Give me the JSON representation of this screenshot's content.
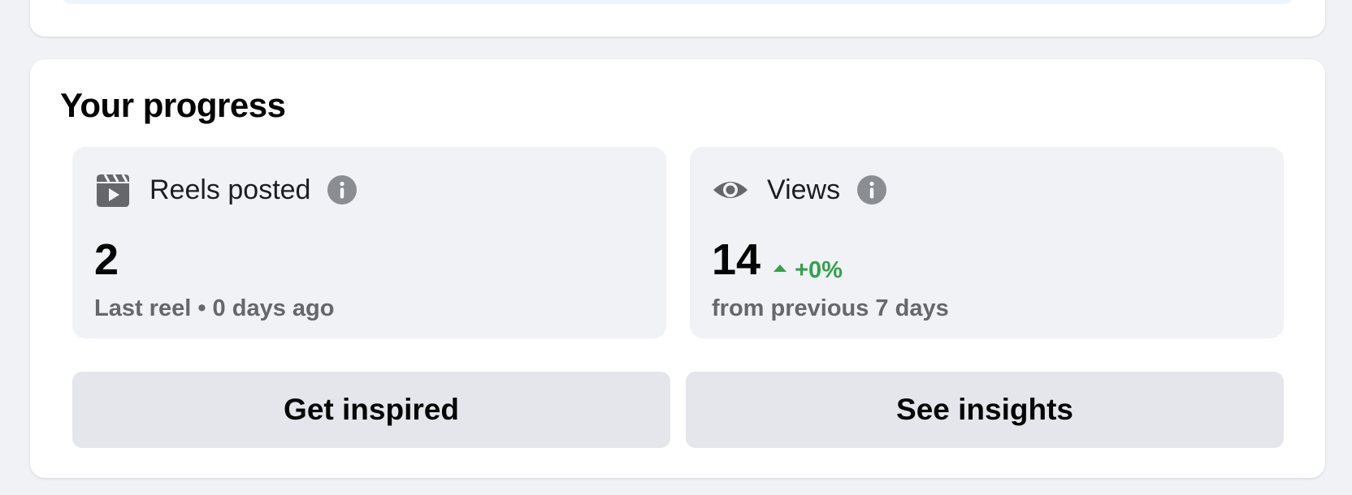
{
  "progress": {
    "title": "Your progress",
    "reels_tile": {
      "icon": "reels-icon",
      "label": "Reels posted",
      "info_icon": "info-icon",
      "value": "2",
      "subtext": "Last reel • 0 days ago"
    },
    "views_tile": {
      "icon": "eye-icon",
      "label": "Views",
      "info_icon": "info-icon",
      "value": "14",
      "change": "+0%",
      "change_direction": "up",
      "subtext": "from previous 7 days"
    },
    "buttons": {
      "get_inspired": "Get inspired",
      "see_insights": "See insights"
    }
  },
  "colors": {
    "page_background": "#f0f2f5",
    "card_background": "#ffffff",
    "tile_background": "#f0f2f5",
    "button_background": "#e4e6eb",
    "positive_change": "#31a24c",
    "secondary_text": "#65676b",
    "icon_gray": "#65676b",
    "info_icon_gray": "#8a8d91"
  }
}
